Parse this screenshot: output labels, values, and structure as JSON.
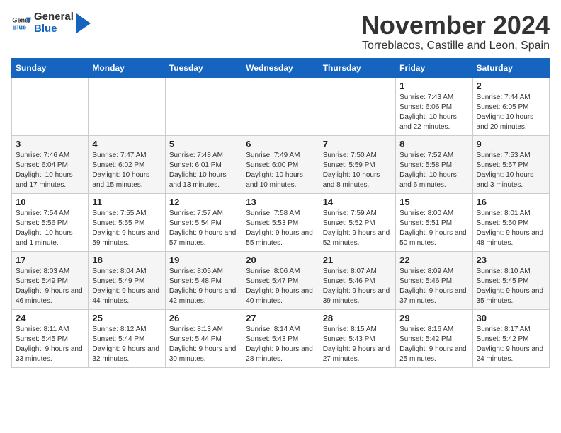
{
  "logo": {
    "general": "General",
    "blue": "Blue"
  },
  "header": {
    "month": "November 2024",
    "location": "Torreblacos, Castille and Leon, Spain"
  },
  "weekdays": [
    "Sunday",
    "Monday",
    "Tuesday",
    "Wednesday",
    "Thursday",
    "Friday",
    "Saturday"
  ],
  "weeks": [
    [
      {
        "day": "",
        "info": ""
      },
      {
        "day": "",
        "info": ""
      },
      {
        "day": "",
        "info": ""
      },
      {
        "day": "",
        "info": ""
      },
      {
        "day": "",
        "info": ""
      },
      {
        "day": "1",
        "info": "Sunrise: 7:43 AM\nSunset: 6:06 PM\nDaylight: 10 hours and 22 minutes."
      },
      {
        "day": "2",
        "info": "Sunrise: 7:44 AM\nSunset: 6:05 PM\nDaylight: 10 hours and 20 minutes."
      }
    ],
    [
      {
        "day": "3",
        "info": "Sunrise: 7:46 AM\nSunset: 6:04 PM\nDaylight: 10 hours and 17 minutes."
      },
      {
        "day": "4",
        "info": "Sunrise: 7:47 AM\nSunset: 6:02 PM\nDaylight: 10 hours and 15 minutes."
      },
      {
        "day": "5",
        "info": "Sunrise: 7:48 AM\nSunset: 6:01 PM\nDaylight: 10 hours and 13 minutes."
      },
      {
        "day": "6",
        "info": "Sunrise: 7:49 AM\nSunset: 6:00 PM\nDaylight: 10 hours and 10 minutes."
      },
      {
        "day": "7",
        "info": "Sunrise: 7:50 AM\nSunset: 5:59 PM\nDaylight: 10 hours and 8 minutes."
      },
      {
        "day": "8",
        "info": "Sunrise: 7:52 AM\nSunset: 5:58 PM\nDaylight: 10 hours and 6 minutes."
      },
      {
        "day": "9",
        "info": "Sunrise: 7:53 AM\nSunset: 5:57 PM\nDaylight: 10 hours and 3 minutes."
      }
    ],
    [
      {
        "day": "10",
        "info": "Sunrise: 7:54 AM\nSunset: 5:56 PM\nDaylight: 10 hours and 1 minute."
      },
      {
        "day": "11",
        "info": "Sunrise: 7:55 AM\nSunset: 5:55 PM\nDaylight: 9 hours and 59 minutes."
      },
      {
        "day": "12",
        "info": "Sunrise: 7:57 AM\nSunset: 5:54 PM\nDaylight: 9 hours and 57 minutes."
      },
      {
        "day": "13",
        "info": "Sunrise: 7:58 AM\nSunset: 5:53 PM\nDaylight: 9 hours and 55 minutes."
      },
      {
        "day": "14",
        "info": "Sunrise: 7:59 AM\nSunset: 5:52 PM\nDaylight: 9 hours and 52 minutes."
      },
      {
        "day": "15",
        "info": "Sunrise: 8:00 AM\nSunset: 5:51 PM\nDaylight: 9 hours and 50 minutes."
      },
      {
        "day": "16",
        "info": "Sunrise: 8:01 AM\nSunset: 5:50 PM\nDaylight: 9 hours and 48 minutes."
      }
    ],
    [
      {
        "day": "17",
        "info": "Sunrise: 8:03 AM\nSunset: 5:49 PM\nDaylight: 9 hours and 46 minutes."
      },
      {
        "day": "18",
        "info": "Sunrise: 8:04 AM\nSunset: 5:49 PM\nDaylight: 9 hours and 44 minutes."
      },
      {
        "day": "19",
        "info": "Sunrise: 8:05 AM\nSunset: 5:48 PM\nDaylight: 9 hours and 42 minutes."
      },
      {
        "day": "20",
        "info": "Sunrise: 8:06 AM\nSunset: 5:47 PM\nDaylight: 9 hours and 40 minutes."
      },
      {
        "day": "21",
        "info": "Sunrise: 8:07 AM\nSunset: 5:46 PM\nDaylight: 9 hours and 39 minutes."
      },
      {
        "day": "22",
        "info": "Sunrise: 8:09 AM\nSunset: 5:46 PM\nDaylight: 9 hours and 37 minutes."
      },
      {
        "day": "23",
        "info": "Sunrise: 8:10 AM\nSunset: 5:45 PM\nDaylight: 9 hours and 35 minutes."
      }
    ],
    [
      {
        "day": "24",
        "info": "Sunrise: 8:11 AM\nSunset: 5:45 PM\nDaylight: 9 hours and 33 minutes."
      },
      {
        "day": "25",
        "info": "Sunrise: 8:12 AM\nSunset: 5:44 PM\nDaylight: 9 hours and 32 minutes."
      },
      {
        "day": "26",
        "info": "Sunrise: 8:13 AM\nSunset: 5:44 PM\nDaylight: 9 hours and 30 minutes."
      },
      {
        "day": "27",
        "info": "Sunrise: 8:14 AM\nSunset: 5:43 PM\nDaylight: 9 hours and 28 minutes."
      },
      {
        "day": "28",
        "info": "Sunrise: 8:15 AM\nSunset: 5:43 PM\nDaylight: 9 hours and 27 minutes."
      },
      {
        "day": "29",
        "info": "Sunrise: 8:16 AM\nSunset: 5:42 PM\nDaylight: 9 hours and 25 minutes."
      },
      {
        "day": "30",
        "info": "Sunrise: 8:17 AM\nSunset: 5:42 PM\nDaylight: 9 hours and 24 minutes."
      }
    ]
  ]
}
